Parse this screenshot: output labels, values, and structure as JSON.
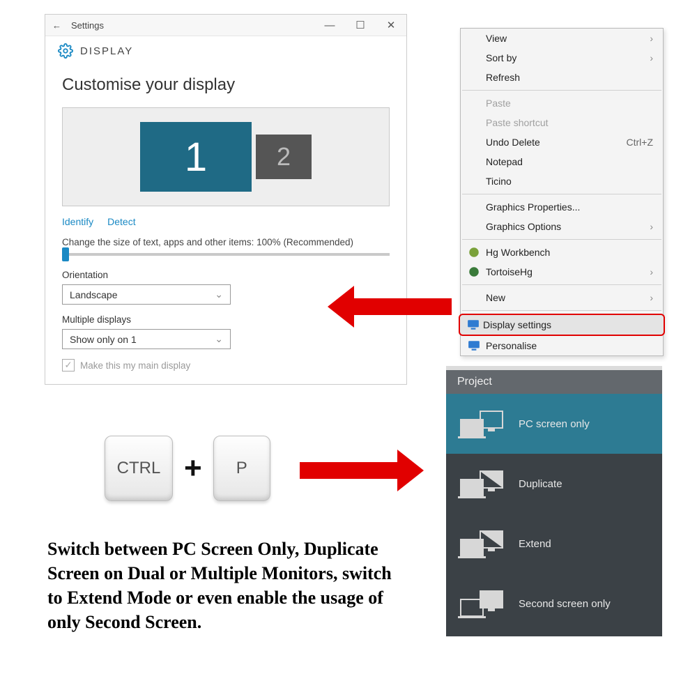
{
  "settings": {
    "back_label": "←",
    "title": "Settings",
    "section": "DISPLAY",
    "heading": "Customise your display",
    "monitor1": "1",
    "monitor2": "2",
    "identify": "Identify",
    "detect": "Detect",
    "scale_label": "Change the size of text, apps and other items: 100% (Recommended)",
    "orientation_label": "Orientation",
    "orientation_value": "Landscape",
    "multi_label": "Multiple displays",
    "multi_value": "Show only on 1",
    "main_display": "Make this my main display"
  },
  "context_menu": {
    "view": "View",
    "sortby": "Sort by",
    "refresh": "Refresh",
    "paste": "Paste",
    "paste_shortcut": "Paste shortcut",
    "undo_delete": "Undo Delete",
    "undo_shortcut": "Ctrl+Z",
    "notepad": "Notepad",
    "ticino": "Ticino",
    "graphics_props": "Graphics Properties...",
    "graphics_opts": "Graphics Options",
    "hg_workbench": "Hg Workbench",
    "tortoisehg": "TortoiseHg",
    "new": "New",
    "display_settings": "Display settings",
    "personalise": "Personalise"
  },
  "keys": {
    "ctrl": "CTRL",
    "plus": "+",
    "p": "P"
  },
  "project": {
    "header": "Project",
    "pc_only": "PC screen only",
    "duplicate": "Duplicate",
    "extend": "Extend",
    "second_only": "Second screen only"
  },
  "description": "Switch between PC Screen Only, Duplicate Screen on Dual or Multiple Monitors, switch to Extend Mode or even enable the usage of only Second Screen."
}
